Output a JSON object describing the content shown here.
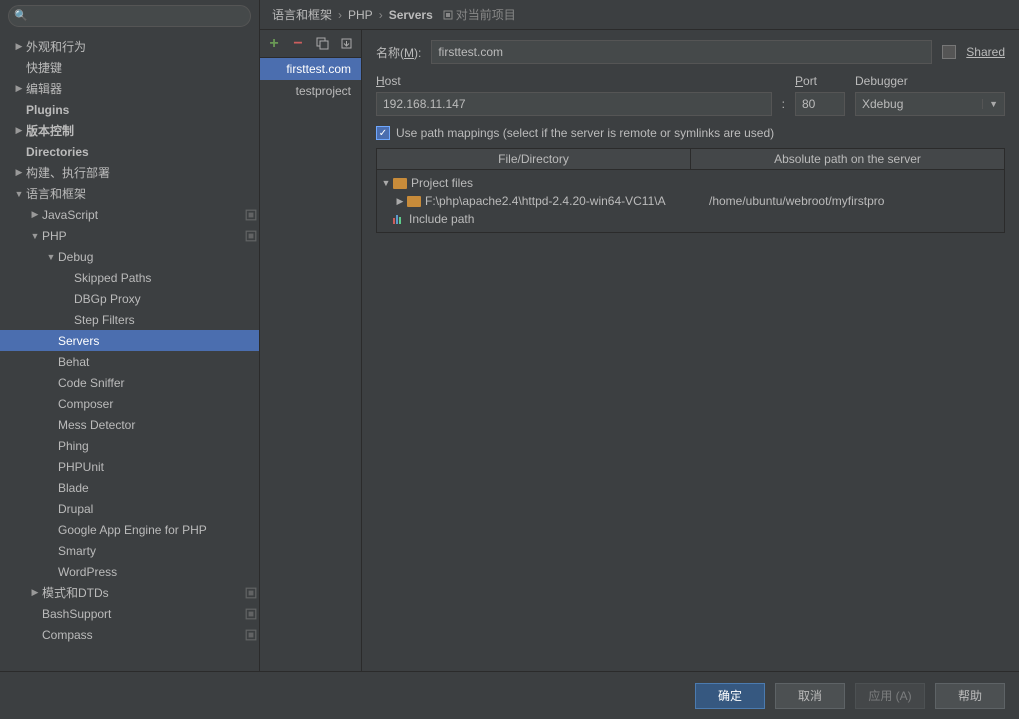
{
  "search": {
    "placeholder": ""
  },
  "sidebar": {
    "items": [
      {
        "label": "外观和行为",
        "depth": 0,
        "arrow": "right",
        "bold": false,
        "badge": false
      },
      {
        "label": "快捷键",
        "depth": 0,
        "arrow": "none",
        "bold": false,
        "badge": false
      },
      {
        "label": "编辑器",
        "depth": 0,
        "arrow": "right",
        "bold": false,
        "badge": false
      },
      {
        "label": "Plugins",
        "depth": 0,
        "arrow": "none",
        "bold": true,
        "badge": false
      },
      {
        "label": "版本控制",
        "depth": 0,
        "arrow": "right",
        "bold": true,
        "badge": false
      },
      {
        "label": "Directories",
        "depth": 0,
        "arrow": "none",
        "bold": true,
        "badge": false
      },
      {
        "label": "构建、执行部署",
        "depth": 0,
        "arrow": "right",
        "bold": false,
        "badge": false
      },
      {
        "label": "语言和框架",
        "depth": 0,
        "arrow": "down",
        "bold": false,
        "badge": false
      },
      {
        "label": "JavaScript",
        "depth": 1,
        "arrow": "right",
        "bold": false,
        "badge": true
      },
      {
        "label": "PHP",
        "depth": 1,
        "arrow": "down",
        "bold": false,
        "badge": true
      },
      {
        "label": "Debug",
        "depth": 2,
        "arrow": "down",
        "bold": false,
        "badge": false
      },
      {
        "label": "Skipped Paths",
        "depth": 3,
        "arrow": "none",
        "bold": false,
        "badge": false
      },
      {
        "label": "DBGp Proxy",
        "depth": 3,
        "arrow": "none",
        "bold": false,
        "badge": false
      },
      {
        "label": "Step Filters",
        "depth": 3,
        "arrow": "none",
        "bold": false,
        "badge": false
      },
      {
        "label": "Servers",
        "depth": 2,
        "arrow": "none",
        "bold": false,
        "badge": false,
        "selected": true
      },
      {
        "label": "Behat",
        "depth": 2,
        "arrow": "none",
        "bold": false,
        "badge": false
      },
      {
        "label": "Code Sniffer",
        "depth": 2,
        "arrow": "none",
        "bold": false,
        "badge": false
      },
      {
        "label": "Composer",
        "depth": 2,
        "arrow": "none",
        "bold": false,
        "badge": false
      },
      {
        "label": "Mess Detector",
        "depth": 2,
        "arrow": "none",
        "bold": false,
        "badge": false
      },
      {
        "label": "Phing",
        "depth": 2,
        "arrow": "none",
        "bold": false,
        "badge": false
      },
      {
        "label": "PHPUnit",
        "depth": 2,
        "arrow": "none",
        "bold": false,
        "badge": false
      },
      {
        "label": "Blade",
        "depth": 2,
        "arrow": "none",
        "bold": false,
        "badge": false
      },
      {
        "label": "Drupal",
        "depth": 2,
        "arrow": "none",
        "bold": false,
        "badge": false
      },
      {
        "label": "Google App Engine for PHP",
        "depth": 2,
        "arrow": "none",
        "bold": false,
        "badge": false
      },
      {
        "label": "Smarty",
        "depth": 2,
        "arrow": "none",
        "bold": false,
        "badge": false
      },
      {
        "label": "WordPress",
        "depth": 2,
        "arrow": "none",
        "bold": false,
        "badge": false
      },
      {
        "label": "模式和DTDs",
        "depth": 1,
        "arrow": "right",
        "bold": false,
        "badge": true
      },
      {
        "label": "BashSupport",
        "depth": 1,
        "arrow": "none",
        "bold": false,
        "badge": true
      },
      {
        "label": "Compass",
        "depth": 1,
        "arrow": "none",
        "bold": false,
        "badge": true
      }
    ]
  },
  "breadcrumb": {
    "parts": [
      "语言和框架",
      "PHP",
      "Servers"
    ],
    "project_badge": "对当前项目"
  },
  "server_list": {
    "items": [
      {
        "label": "firsttest.com",
        "selected": true
      },
      {
        "label": "testproject",
        "selected": false
      }
    ]
  },
  "form": {
    "name_label": "名称(M):",
    "name_value": "firsttest.com",
    "shared_label": "Shared",
    "host_label": "Host",
    "host_value": "192.168.11.147",
    "port_label": "Port",
    "port_value": "80",
    "port_sep": ":",
    "debugger_label": "Debugger",
    "debugger_value": "Xdebug",
    "use_mappings_label": "Use path mappings (select if the server is remote or symlinks are used)",
    "table": {
      "col1": "File/Directory",
      "col2": "Absolute path on the server",
      "project_files": "Project files",
      "local_path": "F:\\php\\apache2.4\\httpd-2.4.20-win64-VC11\\A",
      "remote_path": "/home/ubuntu/webroot/myfirstpro",
      "include_path": "Include path"
    }
  },
  "buttons": {
    "ok": "确定",
    "cancel": "取消",
    "apply": "应用 (A)",
    "help": "帮助"
  }
}
